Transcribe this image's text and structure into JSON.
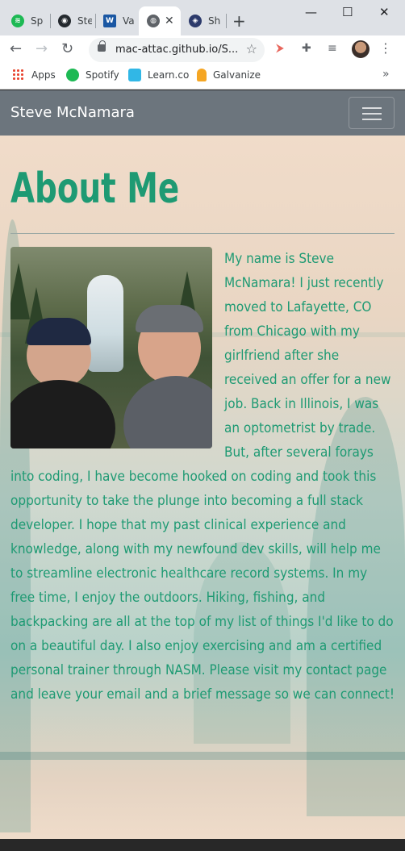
{
  "browser": {
    "tabs": [
      {
        "label": "Sp",
        "icon": "spotify-icon",
        "color": "#1db954"
      },
      {
        "label": "Ste",
        "icon": "github-icon",
        "color": "#24292e"
      },
      {
        "label": "Va",
        "icon": "w3schools-icon",
        "color": "#1a57a3"
      },
      {
        "label": "",
        "icon": "globe-icon",
        "color": "#5f6368"
      },
      {
        "label": "Sh",
        "icon": "owl-icon",
        "color": "#2c3a6b"
      }
    ],
    "active_tab_close": "✕",
    "new_tab": "+",
    "window": {
      "minimize": "—",
      "maximize": "☐",
      "close": "✕"
    },
    "url": "mac-attac.github.io/S...",
    "bookmarks": [
      {
        "label": "Apps",
        "icon": "apps-grid-icon"
      },
      {
        "label": "Spotify",
        "icon": "spotify-icon"
      },
      {
        "label": "Learn.co",
        "icon": "learn-icon"
      },
      {
        "label": "Galvanize",
        "icon": "galvanize-icon"
      }
    ],
    "bookmarks_more": "»"
  },
  "site": {
    "brand": "Steve McNamara",
    "heading": "About Me",
    "about_text": "My name is Steve McNamara! I just recently moved to Lafayette, CO from Chicago with my girlfriend after she received an offer for a new job. Back in Illinois, I was an optometrist by trade. But, after several forays into coding, I have become hooked on coding and took this opportunity to take the plunge into becoming a full stack developer. I hope that my past clinical experience and knowledge, along with my newfound dev skills, will help me to streamline electronic healthcare record systems. In my free time, I enjoy the outdoors. Hiking, fishing, and backpacking are all at the top of my list of things I'd like to do on a beautiful day. I also enjoy exercising and am a certified personal trainer through NASM. Please visit my contact page and leave your email and a brief message so we can connect!"
  },
  "colors": {
    "accent": "#1e9a73",
    "navbar": "#6c757d"
  }
}
